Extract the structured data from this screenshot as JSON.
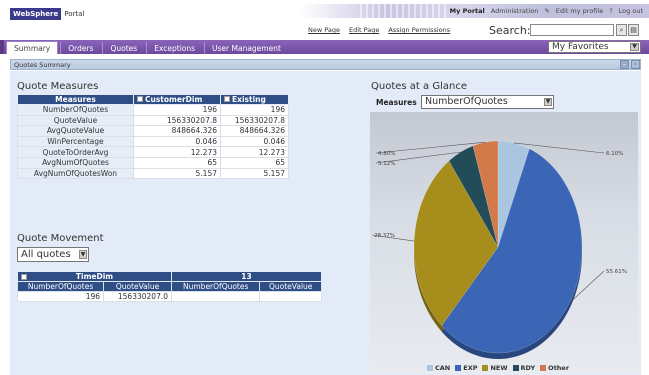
{
  "header": {
    "logo_brand": "WebSphere",
    "logo_text": "Portal",
    "top_links": [
      "My Portal",
      "Administration",
      "Edit my profile",
      "Log out"
    ],
    "help_label": "?",
    "sub_links": [
      "New Page",
      "Edit Page",
      "Assign Permissions"
    ],
    "search_label": "Search:",
    "search_value": ""
  },
  "tabs": {
    "items": [
      "Summary",
      "Orders",
      "Quotes",
      "Exceptions",
      "User Management"
    ],
    "active": "Summary",
    "favorites": "My Favorites"
  },
  "portlet": {
    "title": "Quotes Summary",
    "minimize": "–",
    "maximize": "□"
  },
  "quote_measures": {
    "title": "Quote Measures",
    "headers": [
      "Measures",
      "CustomerDim",
      "Existing"
    ],
    "rows": [
      {
        "label": "NumberOfQuotes",
        "customer": "196",
        "existing": "196"
      },
      {
        "label": "QuoteValue",
        "customer": "156330207.8",
        "existing": "156330207.8"
      },
      {
        "label": "AvgQuoteValue",
        "customer": "848664.326",
        "existing": "848664.326"
      },
      {
        "label": "WinPercentage",
        "customer": "0.046",
        "existing": "0.046"
      },
      {
        "label": "QuoteToOrderAvg",
        "customer": "12.273",
        "existing": "12.273"
      },
      {
        "label": "AvgNumOfQuotes",
        "customer": "65",
        "existing": "65"
      },
      {
        "label": "AvgNumOfQuotesWon",
        "customer": "5.157",
        "existing": "5.157"
      }
    ]
  },
  "quote_movement": {
    "title": "Quote Movement",
    "select_value": "All quotes",
    "dim_header": "TimeDim",
    "period_header": "13",
    "subheaders": [
      "NumberOfQuotes",
      "QuoteValue",
      "NumberOfQuotes",
      "QuoteValue"
    ],
    "row": [
      "196",
      "156330207.0",
      "",
      ""
    ]
  },
  "chart_panel": {
    "title": "Quotes at a Glance",
    "measures_label": "Measures",
    "measures_value": "NumberOfQuotes"
  },
  "chart_data": {
    "type": "pie",
    "title": "",
    "categories": [
      "CAN",
      "EXP",
      "NEW",
      "RDY",
      "Other"
    ],
    "values": [
      6.1,
      55.61,
      28.37,
      5.12,
      4.8
    ],
    "value_labels": [
      "6.10%",
      "55.61%",
      "28.37%",
      "5.12%",
      "4.80%"
    ],
    "colors": [
      "#a9c5df",
      "#3b66b5",
      "#a68d1c",
      "#234c59",
      "#d27a49"
    ],
    "legend_position": "bottom"
  }
}
